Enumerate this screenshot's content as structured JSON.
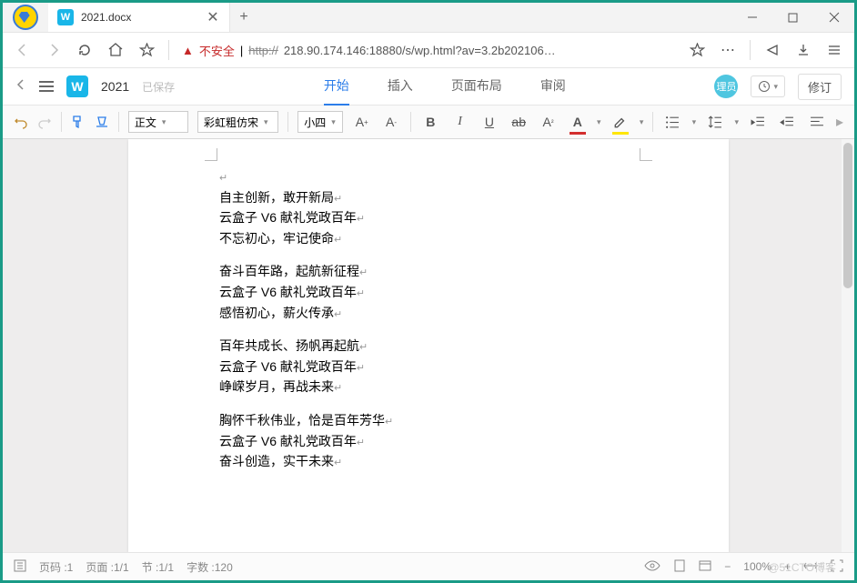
{
  "titlebar": {
    "tab_title": "2021.docx"
  },
  "navbar": {
    "security_label": "不安全",
    "url_protocol": "http://",
    "url_display": "218.90.174.146:18880/s/wp.html?av=3.2b202106…"
  },
  "doc_header": {
    "doc_name": "2021",
    "saved_label": "已保存",
    "menu": [
      "开始",
      "插入",
      "页面布局",
      "审阅"
    ],
    "user_badge": "理员",
    "revise_label": "修订"
  },
  "toolbar": {
    "style_select": "正文",
    "font_select": "彩虹粗仿宋",
    "size_select": "小四"
  },
  "document": {
    "stanzas": [
      [
        "自主创新，敢开新局",
        "云盒子 V6 献礼党政百年",
        "不忘初心，牢记使命"
      ],
      [
        "奋斗百年路，起航新征程",
        "云盒子 V6 献礼党政百年",
        "感悟初心，薪火传承"
      ],
      [
        "百年共成长、扬帆再起航",
        "云盒子 V6 献礼党政百年",
        "峥嵘岁月，再战未来"
      ],
      [
        "胸怀千秋伟业，恰是百年芳华",
        "云盒子 V6 献礼党政百年",
        "奋斗创造，实干未来"
      ]
    ]
  },
  "statusbar": {
    "page_code": "页码 :1",
    "page_of": "页面 :1/1",
    "section": "节 :1/1",
    "words": "字数 :120",
    "zoom": "100%"
  },
  "watermark": "@51CTO博客"
}
